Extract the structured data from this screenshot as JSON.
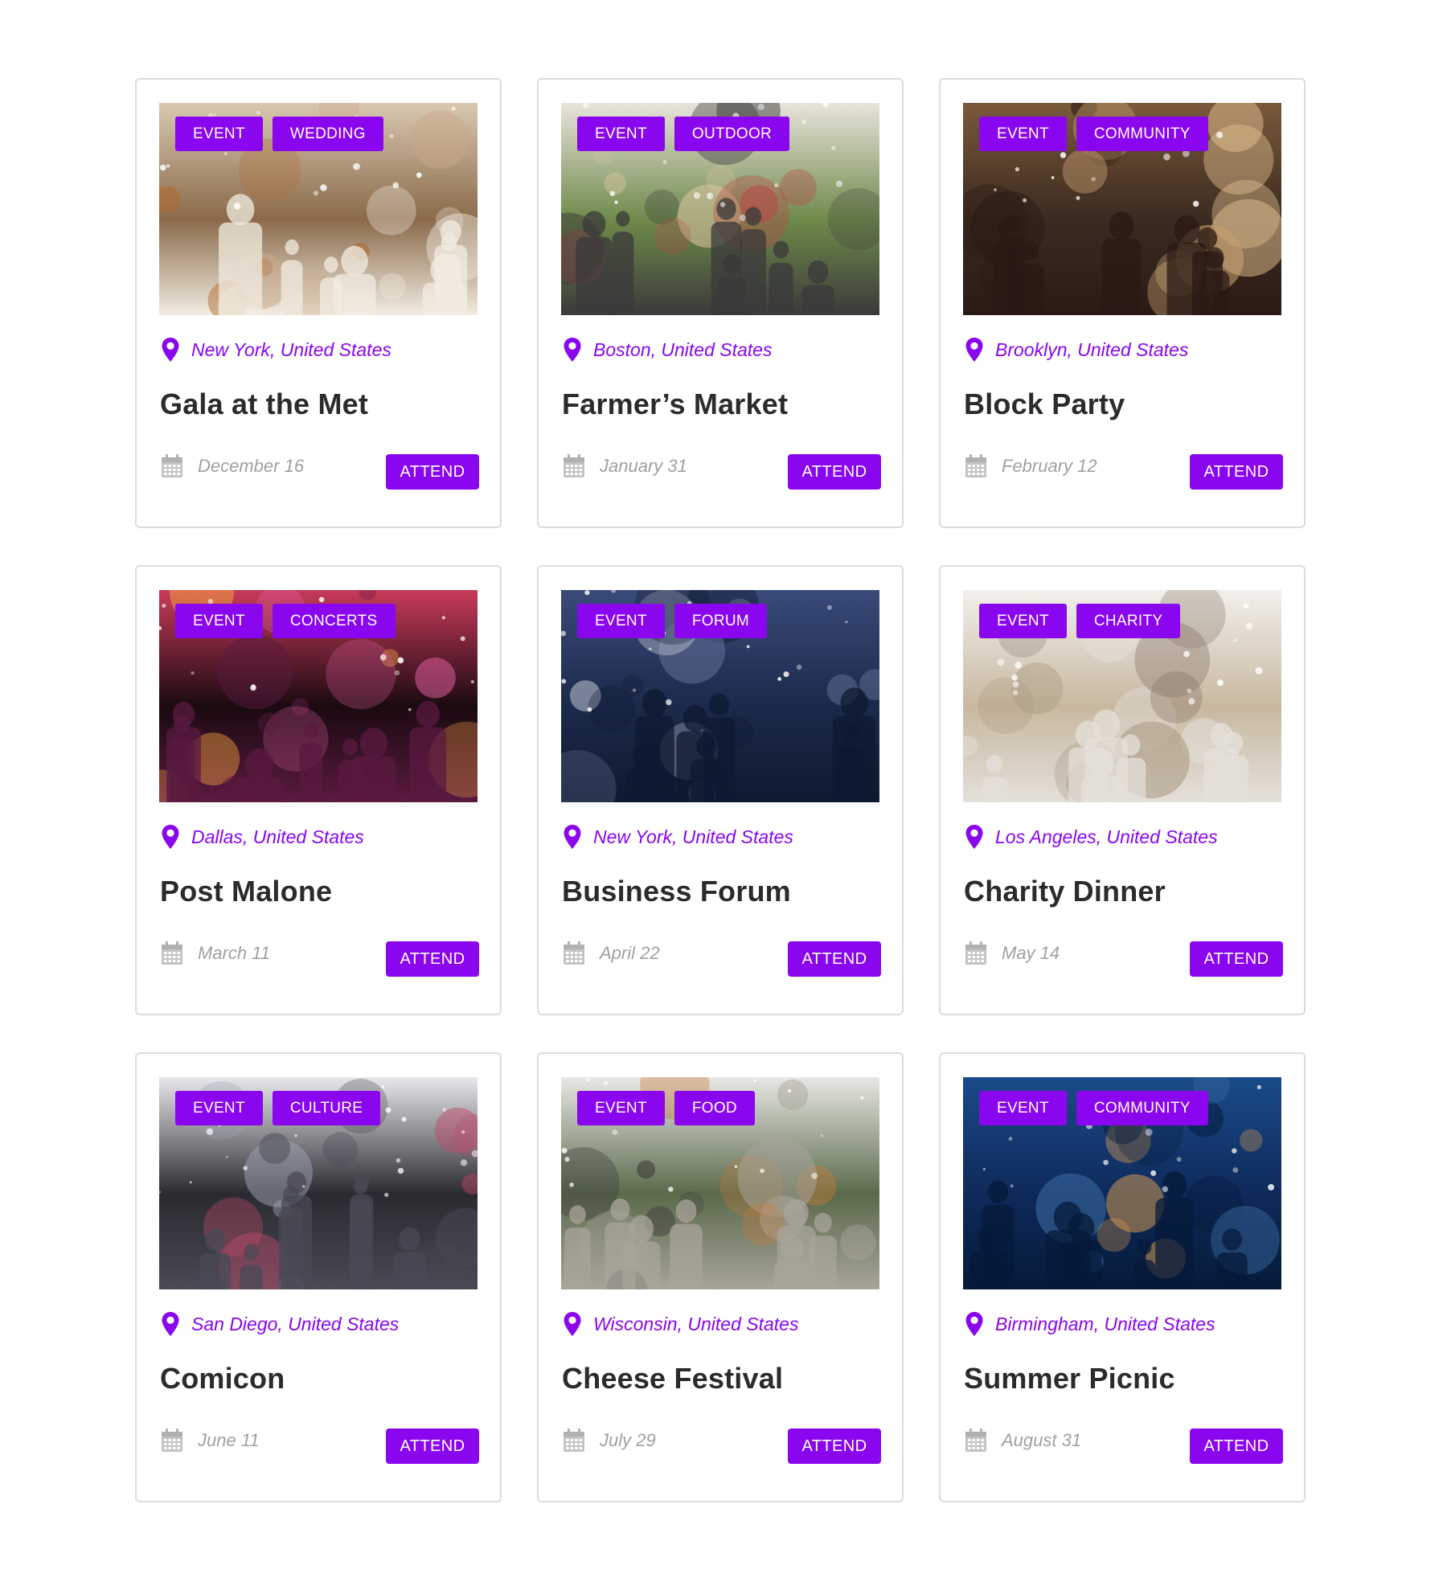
{
  "accent_color": "#8a06ee",
  "icons": {
    "location": "map-pin-icon",
    "date": "calendar-icon"
  },
  "events": [
    {
      "tags": [
        "EVENT",
        "WEDDING"
      ],
      "location": "New York, United States",
      "title": "Gala at the Met",
      "date": "December 16",
      "button": "ATTEND",
      "image": "banquet table with glasses and flowers",
      "palette": [
        "#8a6a4a",
        "#d8c8b0",
        "#b06a30",
        "#f2ece0",
        "#c9a88a"
      ]
    },
    {
      "tags": [
        "EVENT",
        "OUTDOOR"
      ],
      "location": "Boston, United States",
      "title": "Farmer’s Market",
      "date": "January 31",
      "button": "ATTEND",
      "image": "people walking at outdoor market",
      "palette": [
        "#6f8a4a",
        "#e8e4dc",
        "#b84a4a",
        "#3a3a3a",
        "#d7c3a0"
      ]
    },
    {
      "tags": [
        "EVENT",
        "COMMUNITY"
      ],
      "location": "Brooklyn, United States",
      "title": "Block Party",
      "date": "February 12",
      "button": "ATTEND",
      "image": "people toasting with champagne",
      "palette": [
        "#3a2a20",
        "#7a5a3a",
        "#e0c090",
        "#2a1a14",
        "#c8a070"
      ]
    },
    {
      "tags": [
        "EVENT",
        "CONCERTS"
      ],
      "location": "Dallas, United States",
      "title": "Post Malone",
      "date": "March 11",
      "button": "ATTEND",
      "image": "concert crowd with stage lights",
      "palette": [
        "#1a0a10",
        "#c83a5a",
        "#f0a040",
        "#5a1a40",
        "#e060a0"
      ]
    },
    {
      "tags": [
        "EVENT",
        "FORUM"
      ],
      "location": "New York, United States",
      "title": "Business Forum",
      "date": "April 22",
      "button": "ATTEND",
      "image": "panel discussion on round stage",
      "palette": [
        "#1a2a4a",
        "#3a4a7a",
        "#d8dce4",
        "#0e1a30",
        "#6a7aa0"
      ]
    },
    {
      "tags": [
        "EVENT",
        "CHARITY"
      ],
      "location": "Los Angeles, United States",
      "title": "Charity Dinner",
      "date": "May 14",
      "button": "ATTEND",
      "image": "conference hall with round tables",
      "palette": [
        "#c8b8a0",
        "#f2f0ec",
        "#8a7a6a",
        "#e4e0da",
        "#a89880"
      ]
    },
    {
      "tags": [
        "EVENT",
        "CULTURE"
      ],
      "location": "San Diego, United States",
      "title": "Comicon",
      "date": "June 11",
      "button": "ATTEND",
      "image": "exhibition hall with seated audience",
      "palette": [
        "#2a2a30",
        "#e8e8ec",
        "#c04a6a",
        "#4a4a55",
        "#9aa0b0"
      ]
    },
    {
      "tags": [
        "EVENT",
        "FOOD"
      ],
      "location": "Wisconsin, United States",
      "title": "Cheese Festival",
      "date": "July 29",
      "button": "ATTEND",
      "image": "crowded outdoor food festival with bunting",
      "palette": [
        "#5a6a4a",
        "#e8e8e4",
        "#3a3a3a",
        "#a8a49a",
        "#c87a3a"
      ]
    },
    {
      "tags": [
        "EVENT",
        "COMMUNITY"
      ],
      "location": "Birmingham, United States",
      "title": "Summer Picnic",
      "date": "August 31",
      "button": "ATTEND",
      "image": "evening picnic table with wine glasses",
      "palette": [
        "#0e2a5a",
        "#1a4a8a",
        "#e0a050",
        "#061a3a",
        "#3a6aa0"
      ]
    }
  ]
}
